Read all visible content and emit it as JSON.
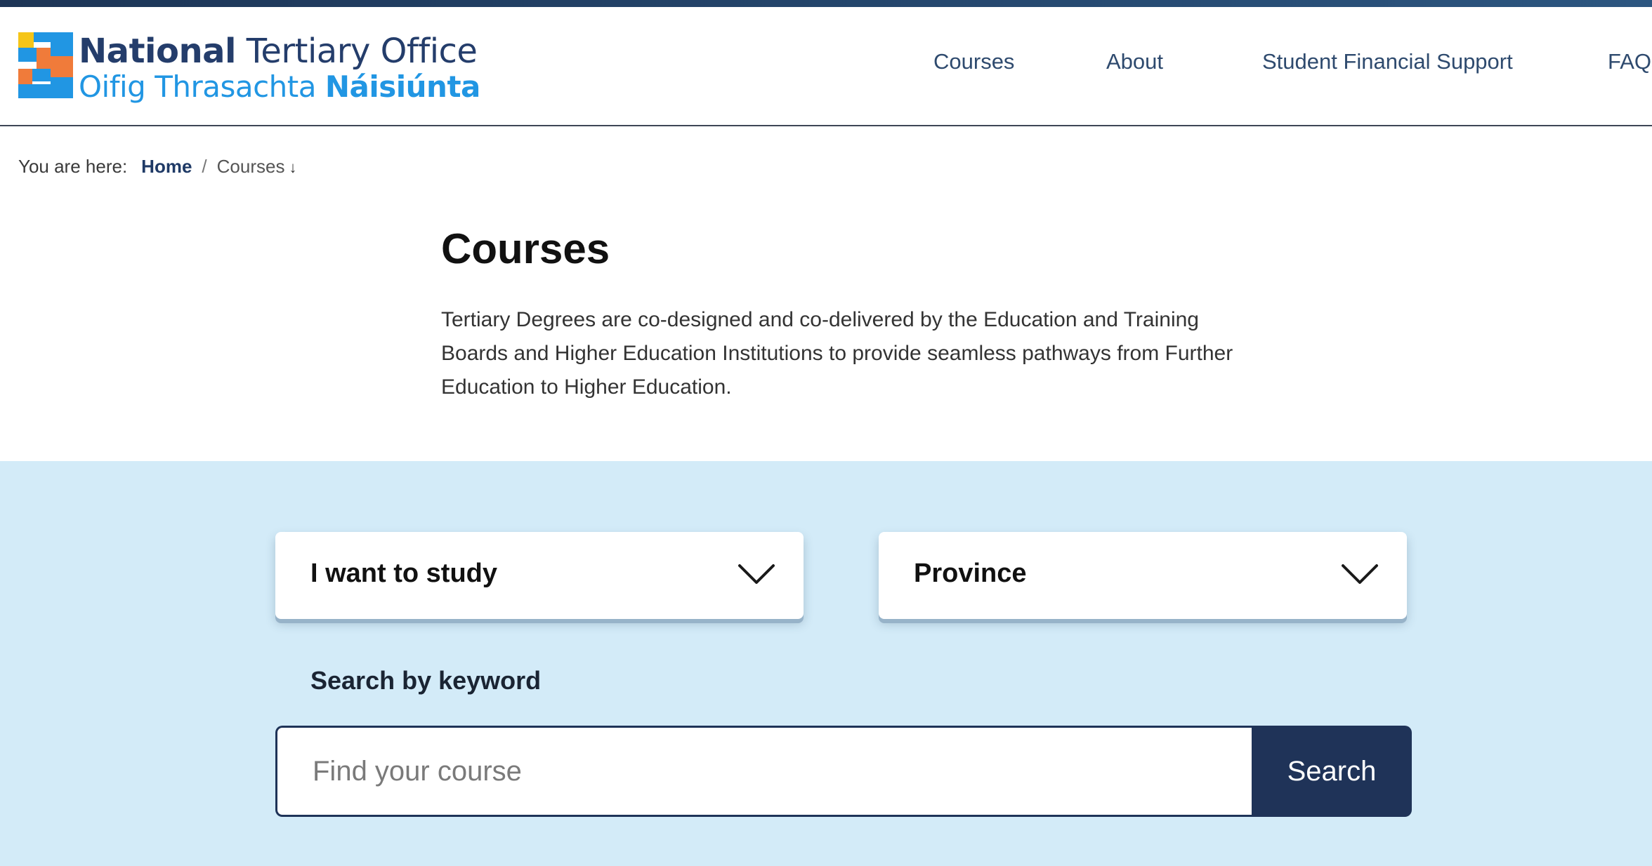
{
  "logo": {
    "line1_bold": "National",
    "line1_rest": " Tertiary Office",
    "line2_rest": "Oifig Thrasachta ",
    "line2_bold": "Náisiúnta"
  },
  "nav": {
    "items": [
      {
        "label": "Courses"
      },
      {
        "label": "About"
      },
      {
        "label": "Student Financial Support"
      },
      {
        "label": "FAQs"
      }
    ]
  },
  "breadcrumb": {
    "prefix": "You are here:",
    "home": "Home",
    "separator": "/",
    "current": "Courses",
    "arrow": "↓"
  },
  "page": {
    "title": "Courses",
    "intro": "Tertiary Degrees are co-designed and co-delivered by the Education and Training Boards and Higher Education Institutions to provide seamless pathways from Further Education to Higher Education."
  },
  "search": {
    "study_select": "I want to study",
    "province_select": "Province",
    "keyword_label": "Search by keyword",
    "placeholder": "Find your course",
    "value": "",
    "button": "Search"
  },
  "colors": {
    "brand_navy": "#1f3358",
    "brand_blue": "#2196e3",
    "band_bg": "#d3ebf8",
    "logo_yellow": "#f5c518",
    "logo_orange": "#f07b3a"
  }
}
